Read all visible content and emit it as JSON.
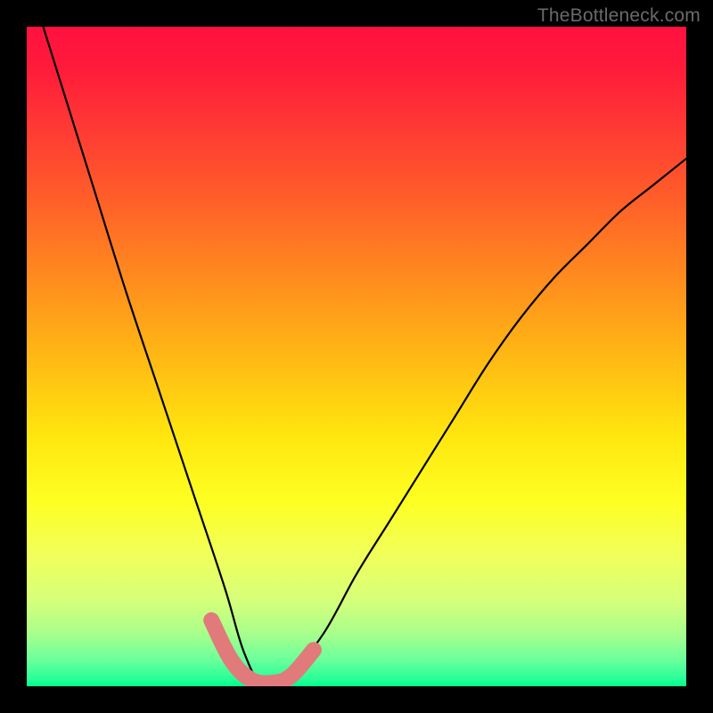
{
  "watermark": "TheBottleneck.com",
  "chart_data": {
    "type": "line",
    "title": "",
    "xlabel": "",
    "ylabel": "",
    "xlim": [
      0,
      1
    ],
    "ylim": [
      0,
      1
    ],
    "series": [
      {
        "name": "bottleneck-curve",
        "comment": "V-shaped 'bottleneck percentage' curve; minimum ≈0 near x≈0.36, rises steeply on both sides. Values are read off the heat-gradient (y=0 at bottom/green ≈ no bottleneck, y=1 at top/red ≈ max).",
        "x": [
          0.0,
          0.05,
          0.1,
          0.15,
          0.2,
          0.25,
          0.3,
          0.33,
          0.36,
          0.4,
          0.45,
          0.5,
          0.55,
          0.6,
          0.65,
          0.7,
          0.75,
          0.8,
          0.85,
          0.9,
          0.95,
          1.0
        ],
        "values": [
          1.08,
          0.92,
          0.76,
          0.6,
          0.45,
          0.3,
          0.15,
          0.05,
          0.0,
          0.02,
          0.08,
          0.17,
          0.25,
          0.33,
          0.41,
          0.49,
          0.56,
          0.62,
          0.67,
          0.72,
          0.76,
          0.8
        ]
      },
      {
        "name": "optimal-range-highlight",
        "comment": "Thick salmon overlay marking the near-zero-bottleneck region along the bottom of the V.",
        "x": [
          0.28,
          0.31,
          0.34,
          0.37,
          0.4,
          0.435
        ],
        "values": [
          0.1,
          0.04,
          0.01,
          0.005,
          0.015,
          0.055
        ]
      }
    ]
  }
}
